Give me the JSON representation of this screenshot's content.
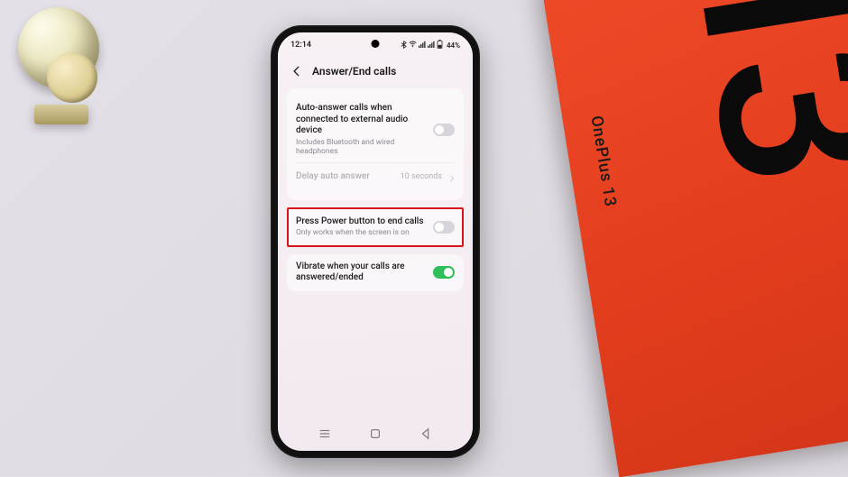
{
  "status": {
    "time": "12:14",
    "battery": "44%"
  },
  "header": {
    "title": "Answer/End calls"
  },
  "rows": {
    "auto_answer": {
      "title": "Auto-answer calls when connected to external audio device",
      "subtitle": "Includes Bluetooth and wired headphones"
    },
    "delay": {
      "title": "Delay auto answer",
      "value": "10 seconds"
    },
    "power_end": {
      "title": "Press Power button to end calls",
      "subtitle": "Only works when the screen is on"
    },
    "vibrate": {
      "title": "Vibrate when your calls are answered/ended"
    }
  },
  "box": {
    "brand": "OnePlus 13",
    "number": "13"
  }
}
